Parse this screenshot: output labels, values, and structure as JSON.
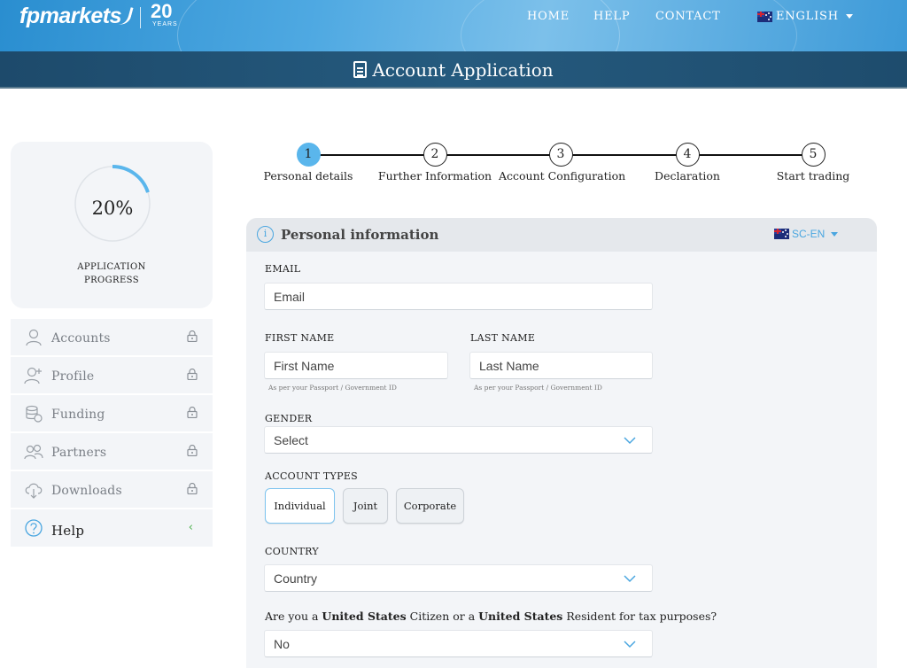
{
  "brand": {
    "name": "fpmarkets",
    "years": "20",
    "years_sub": "YEARS"
  },
  "nav": {
    "home": "HOME",
    "help": "HELP",
    "contact": "CONTACT",
    "language": "ENGLISH"
  },
  "page_title": "Account Application",
  "progress": {
    "value": "20%",
    "percent": 20,
    "label_line1": "APPLICATION",
    "label_line2": "PROGRESS"
  },
  "sidebar": {
    "items": [
      {
        "label": "Accounts",
        "icon": "user-icon",
        "locked": true
      },
      {
        "label": "Profile",
        "icon": "user-plus-icon",
        "locked": true
      },
      {
        "label": "Funding",
        "icon": "coins-icon",
        "locked": true
      },
      {
        "label": "Partners",
        "icon": "users-icon",
        "locked": true
      },
      {
        "label": "Downloads",
        "icon": "cloud-download-icon",
        "locked": true
      }
    ],
    "help": {
      "label": "Help",
      "icon": "question-icon"
    }
  },
  "steps": [
    {
      "number": "1",
      "label": "Personal details",
      "active": true
    },
    {
      "number": "2",
      "label": "Further Information",
      "active": false
    },
    {
      "number": "3",
      "label": "Account Configuration",
      "active": false
    },
    {
      "number": "4",
      "label": "Declaration",
      "active": false
    },
    {
      "number": "5",
      "label": "Start trading",
      "active": false
    }
  ],
  "form": {
    "section_title": "Personal information",
    "locale": "SC-EN",
    "email": {
      "label": "EMAIL",
      "placeholder": "Email"
    },
    "first_name": {
      "label": "FIRST NAME",
      "placeholder": "First Name",
      "hint": "As per your Passport / Government ID"
    },
    "last_name": {
      "label": "LAST NAME",
      "placeholder": "Last Name",
      "hint": "As per your Passport / Government ID"
    },
    "gender": {
      "label": "GENDER",
      "value": "Select"
    },
    "account_types": {
      "label": "ACCOUNT TYPES",
      "options": [
        "Individual",
        "Joint",
        "Corporate"
      ],
      "selected": "Individual"
    },
    "country": {
      "label": "COUNTRY",
      "value": "Country"
    },
    "us_question": {
      "part1": "Are you a ",
      "bold1": "United States",
      "part2": " Citizen or a ",
      "bold2": "United States",
      "part3": " Resident for tax purposes?",
      "value": "No"
    }
  },
  "colors": {
    "accent": "#5ab6ec",
    "header_dark": "#1d4a6b",
    "panel_bg": "#f3f5f8"
  }
}
